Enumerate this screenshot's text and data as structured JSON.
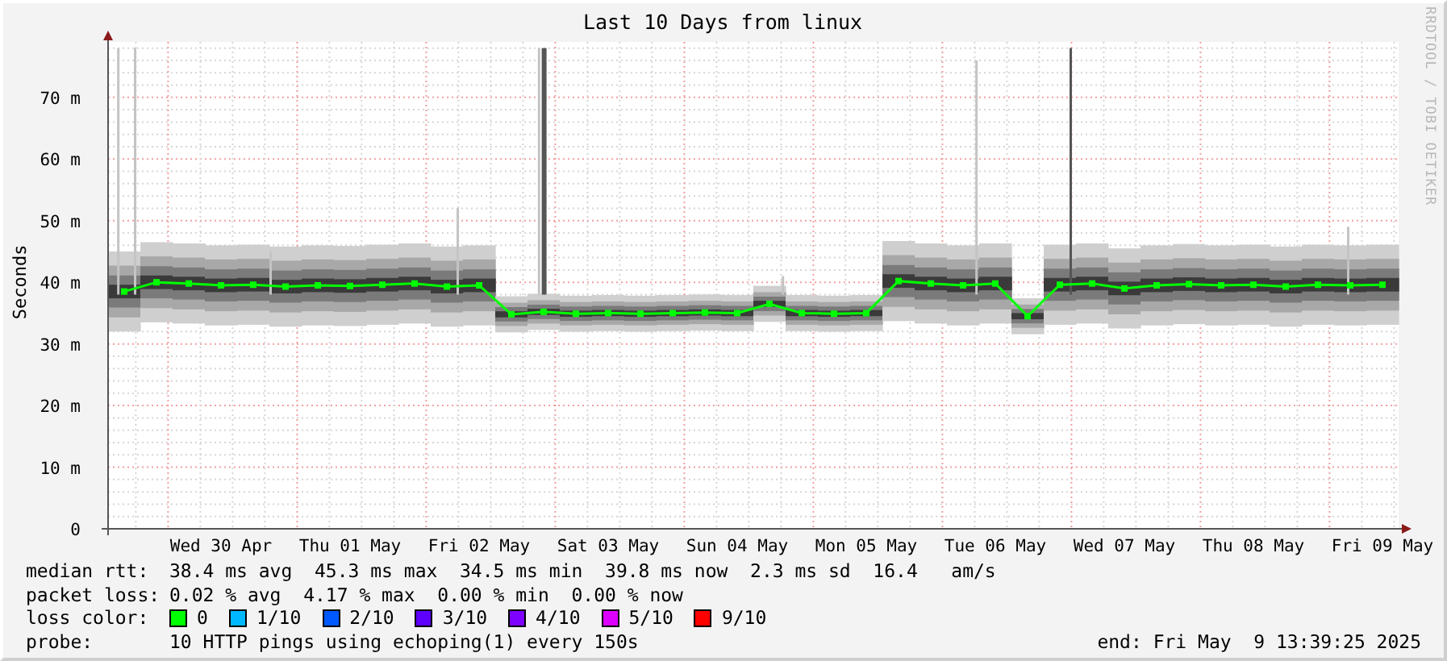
{
  "graph": {
    "title": "Last 10 Days from linux",
    "watermark": "RRDTOOL / TOBI OETIKER",
    "chart_data": {
      "type": "line",
      "grid": true,
      "ylabel": "Seconds",
      "ylim": [
        0,
        79
      ],
      "yticks": [
        {
          "value": 0,
          "label": "0"
        },
        {
          "value": 10,
          "label": "10 m"
        },
        {
          "value": 20,
          "label": "20 m"
        },
        {
          "value": 30,
          "label": "30 m"
        },
        {
          "value": 40,
          "label": "40 m"
        },
        {
          "value": 50,
          "label": "50 m"
        },
        {
          "value": 60,
          "label": "60 m"
        },
        {
          "value": 70,
          "label": "70 m"
        }
      ],
      "categories": [
        null,
        null,
        null,
        "Wed 30 Apr",
        null,
        null,
        null,
        "Thu 01 May",
        null,
        null,
        null,
        "Fri 02 May",
        null,
        null,
        null,
        "Sat 03 May",
        null,
        null,
        null,
        "Sun 04 May",
        null,
        null,
        null,
        "Mon 05 May",
        null,
        null,
        null,
        "Tue 06 May",
        null,
        null,
        null,
        "Wed 07 May",
        null,
        null,
        null,
        "Thu 08 May",
        null,
        null,
        null,
        "Fri 09 May"
      ],
      "series": [
        {
          "color": "#00ff00",
          "marker": true,
          "values": [
            38.5,
            40,
            39.8,
            39.5,
            39.6,
            39.3,
            39.5,
            39.4,
            39.6,
            39.8,
            39.3,
            39.5,
            34.8,
            35.2,
            34.9,
            35,
            34.9,
            35,
            35.1,
            35,
            36.5,
            35,
            34.9,
            35,
            40.2,
            39.8,
            39.5,
            39.8,
            34.5,
            39.6,
            39.8,
            39,
            39.5,
            39.7,
            39.5,
            39.6,
            39.3,
            39.6,
            39.5,
            39.6
          ]
        }
      ]
    }
  },
  "legend": {
    "rows": [
      {
        "label": "median rtt:",
        "text": "38.4 ms avg  45.3 ms max  34.5 ms min  39.8 ms now  2.3 ms sd  16.4   am/s"
      },
      {
        "label": "packet loss:",
        "text": "0.02 % avg  4.17 % max  0.00 % min  0.00 % now"
      }
    ],
    "loss_color": {
      "label": "loss color:",
      "items": [
        {
          "label": "0",
          "color": "#00ff00"
        },
        {
          "label": "1/10",
          "color": "#00b8ff"
        },
        {
          "label": "2/10",
          "color": "#0059ff"
        },
        {
          "label": "3/10",
          "color": "#5e00ff"
        },
        {
          "label": "4/10",
          "color": "#7e00ff"
        },
        {
          "label": "5/10",
          "color": "#dd00ff"
        },
        {
          "label": "9/10",
          "color": "#ff0000"
        }
      ]
    },
    "probe": {
      "label": "probe:",
      "text": "10 HTTP pings using echoping(1) every 150s"
    },
    "end": "end: Fri May  9 13:39:25 2025"
  }
}
